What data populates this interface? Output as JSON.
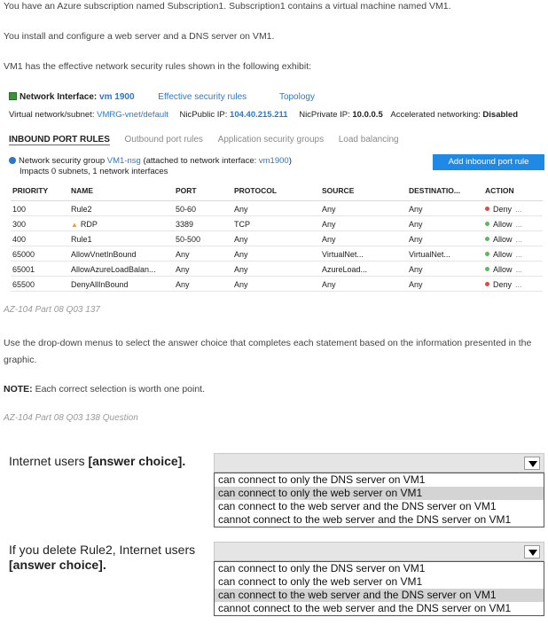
{
  "intro": {
    "p1": "You have an Azure subscription named Subscription1. Subscription1 contains a virtual machine named VM1.",
    "p2": "You install and configure a web server and a DNS server on VM1.",
    "p3": "VM1 has the effective network security rules shown in the following exhibit:"
  },
  "exhibit": {
    "nic_label": "Network Interface:",
    "nic_name": "vm 1900",
    "effective_rules_link": "Effective security rules",
    "topology_link": "Topology",
    "vnet_label": "Virtual network/subnet:",
    "vnet_value": "VMRG-vnet/default",
    "public_ip_label": "NicPublic IP:",
    "public_ip_value": "104.40.215.211",
    "private_ip_label": "NicPrivate IP:",
    "private_ip_value": "10.0.0.5",
    "accel_label": "Accelerated networking:",
    "accel_value": "Disabled",
    "tabs": [
      "INBOUND PORT RULES",
      "Outbound port rules",
      "Application security groups",
      "Load balancing"
    ],
    "nsg_prefix": "Network security group",
    "nsg_name": "VM1-nsg",
    "nsg_attached_prefix": "(attached to network interface:",
    "nsg_attached_name": "vm1900",
    "nsg_attached_suffix": ")",
    "impacts": "Impacts 0 subnets, 1 network interfaces",
    "add_button": "Add inbound port rule",
    "columns": [
      "PRIORITY",
      "NAME",
      "PORT",
      "PROTOCOL",
      "SOURCE",
      "DESTINATIO...",
      "ACTION"
    ],
    "rows": [
      {
        "priority": "100",
        "name": "Rule2",
        "warn": false,
        "port": "50-60",
        "protocol": "Any",
        "source": "Any",
        "destination": "Any",
        "action": "Deny"
      },
      {
        "priority": "300",
        "name": "RDP",
        "warn": true,
        "port": "3389",
        "protocol": "TCP",
        "source": "Any",
        "destination": "Any",
        "action": "Allow"
      },
      {
        "priority": "400",
        "name": "Rule1",
        "warn": false,
        "port": "50-500",
        "protocol": "Any",
        "source": "Any",
        "destination": "Any",
        "action": "Allow"
      },
      {
        "priority": "65000",
        "name": "AllowVnetInBound",
        "warn": false,
        "port": "Any",
        "protocol": "Any",
        "source": "VirtualNet...",
        "destination": "VirtualNet...",
        "action": "Allow"
      },
      {
        "priority": "65001",
        "name": "AllowAzureLoadBalan...",
        "warn": false,
        "port": "Any",
        "protocol": "Any",
        "source": "AzureLoad...",
        "destination": "Any",
        "action": "Allow"
      },
      {
        "priority": "65500",
        "name": "DenyAllInBound",
        "warn": false,
        "port": "Any",
        "protocol": "Any",
        "source": "Any",
        "destination": "Any",
        "action": "Deny"
      }
    ],
    "more_glyph": "..."
  },
  "caption1": "AZ-104 Part 08 Q03 137",
  "instructions": "Use the drop-down menus to select the answer choice that completes each statement based on the information presented in the graphic.",
  "note_label": "NOTE:",
  "note_text": " Each correct selection is worth one point.",
  "caption2": "AZ-104 Part 08 Q03 138 Question",
  "q1": {
    "text": "Internet users ",
    "bold": "[answer choice].",
    "options": [
      "can connect to only the DNS server on VM1",
      "can connect to only the web server on VM1",
      "can connect to the web server and the DNS server on VM1",
      "cannot connect to the web server and the DNS server on VM1"
    ],
    "selected_index": 1
  },
  "q2": {
    "text": "If you delete Rule2, Internet users",
    "bold": "[answer choice].",
    "options": [
      "can connect to only the DNS server on VM1",
      "can connect to only the web server on VM1",
      "can connect to the web server and the DNS server on VM1",
      "cannot connect to the web server and the DNS server on VM1"
    ],
    "selected_index": 2
  },
  "colors": {
    "accent": "#2c78c8",
    "button": "#1e8ae6",
    "deny": "#e04848",
    "allow": "#5cb85c",
    "selected": "#d4d4d4"
  }
}
